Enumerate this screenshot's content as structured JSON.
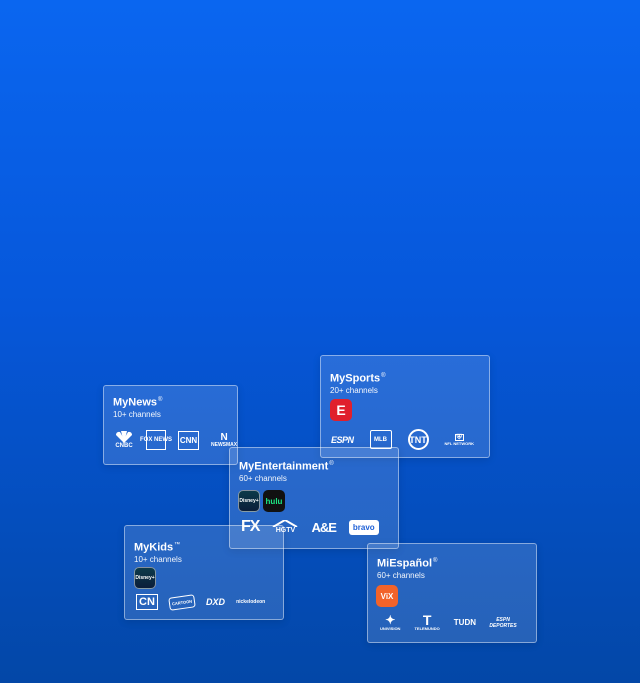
{
  "background": {
    "color_top": "#0a66f0",
    "color_bottom": "#0347a7"
  },
  "cards": {
    "news": {
      "title": "MyNews",
      "trademark": "®",
      "subtitle": "10+ channels",
      "logos": [
        "CNBC",
        "FOX NEWS",
        "CNN",
        "NEWSMAX"
      ]
    },
    "sports": {
      "title": "MySports",
      "trademark": "®",
      "subtitle": "20+ channels",
      "app_icon": "E",
      "logos": [
        "ESPN",
        "MLB",
        "TNT",
        "NFL NETWORK"
      ]
    },
    "entertainment": {
      "title": "MyEntertainment",
      "trademark": "®",
      "subtitle": "60+ channels",
      "apps": [
        "Disney+",
        "hulu"
      ],
      "logos": [
        "FX",
        "HGTV",
        "A&E",
        "bravo"
      ]
    },
    "kids": {
      "title": "MyKids",
      "trademark": "™",
      "subtitle": "10+ channels",
      "app_icon": "Disney+",
      "logos": [
        "CN",
        "CARTOON",
        "DXD",
        "nickelodeon"
      ]
    },
    "espanol": {
      "title": "MiEspañol",
      "trademark": "®",
      "subtitle": "60+ channels",
      "app_icon": "ViX",
      "logos": [
        "UNIVISION",
        "TELEMUNDO",
        "TUDN",
        "ESPN DEPORTES"
      ]
    }
  },
  "colors": {
    "espn_red": "#e0202c",
    "vix_orange": "#f2632a",
    "disney_dark": "#0c2a3a",
    "hulu_dark": "#111111",
    "hulu_green": "#1ce783"
  }
}
